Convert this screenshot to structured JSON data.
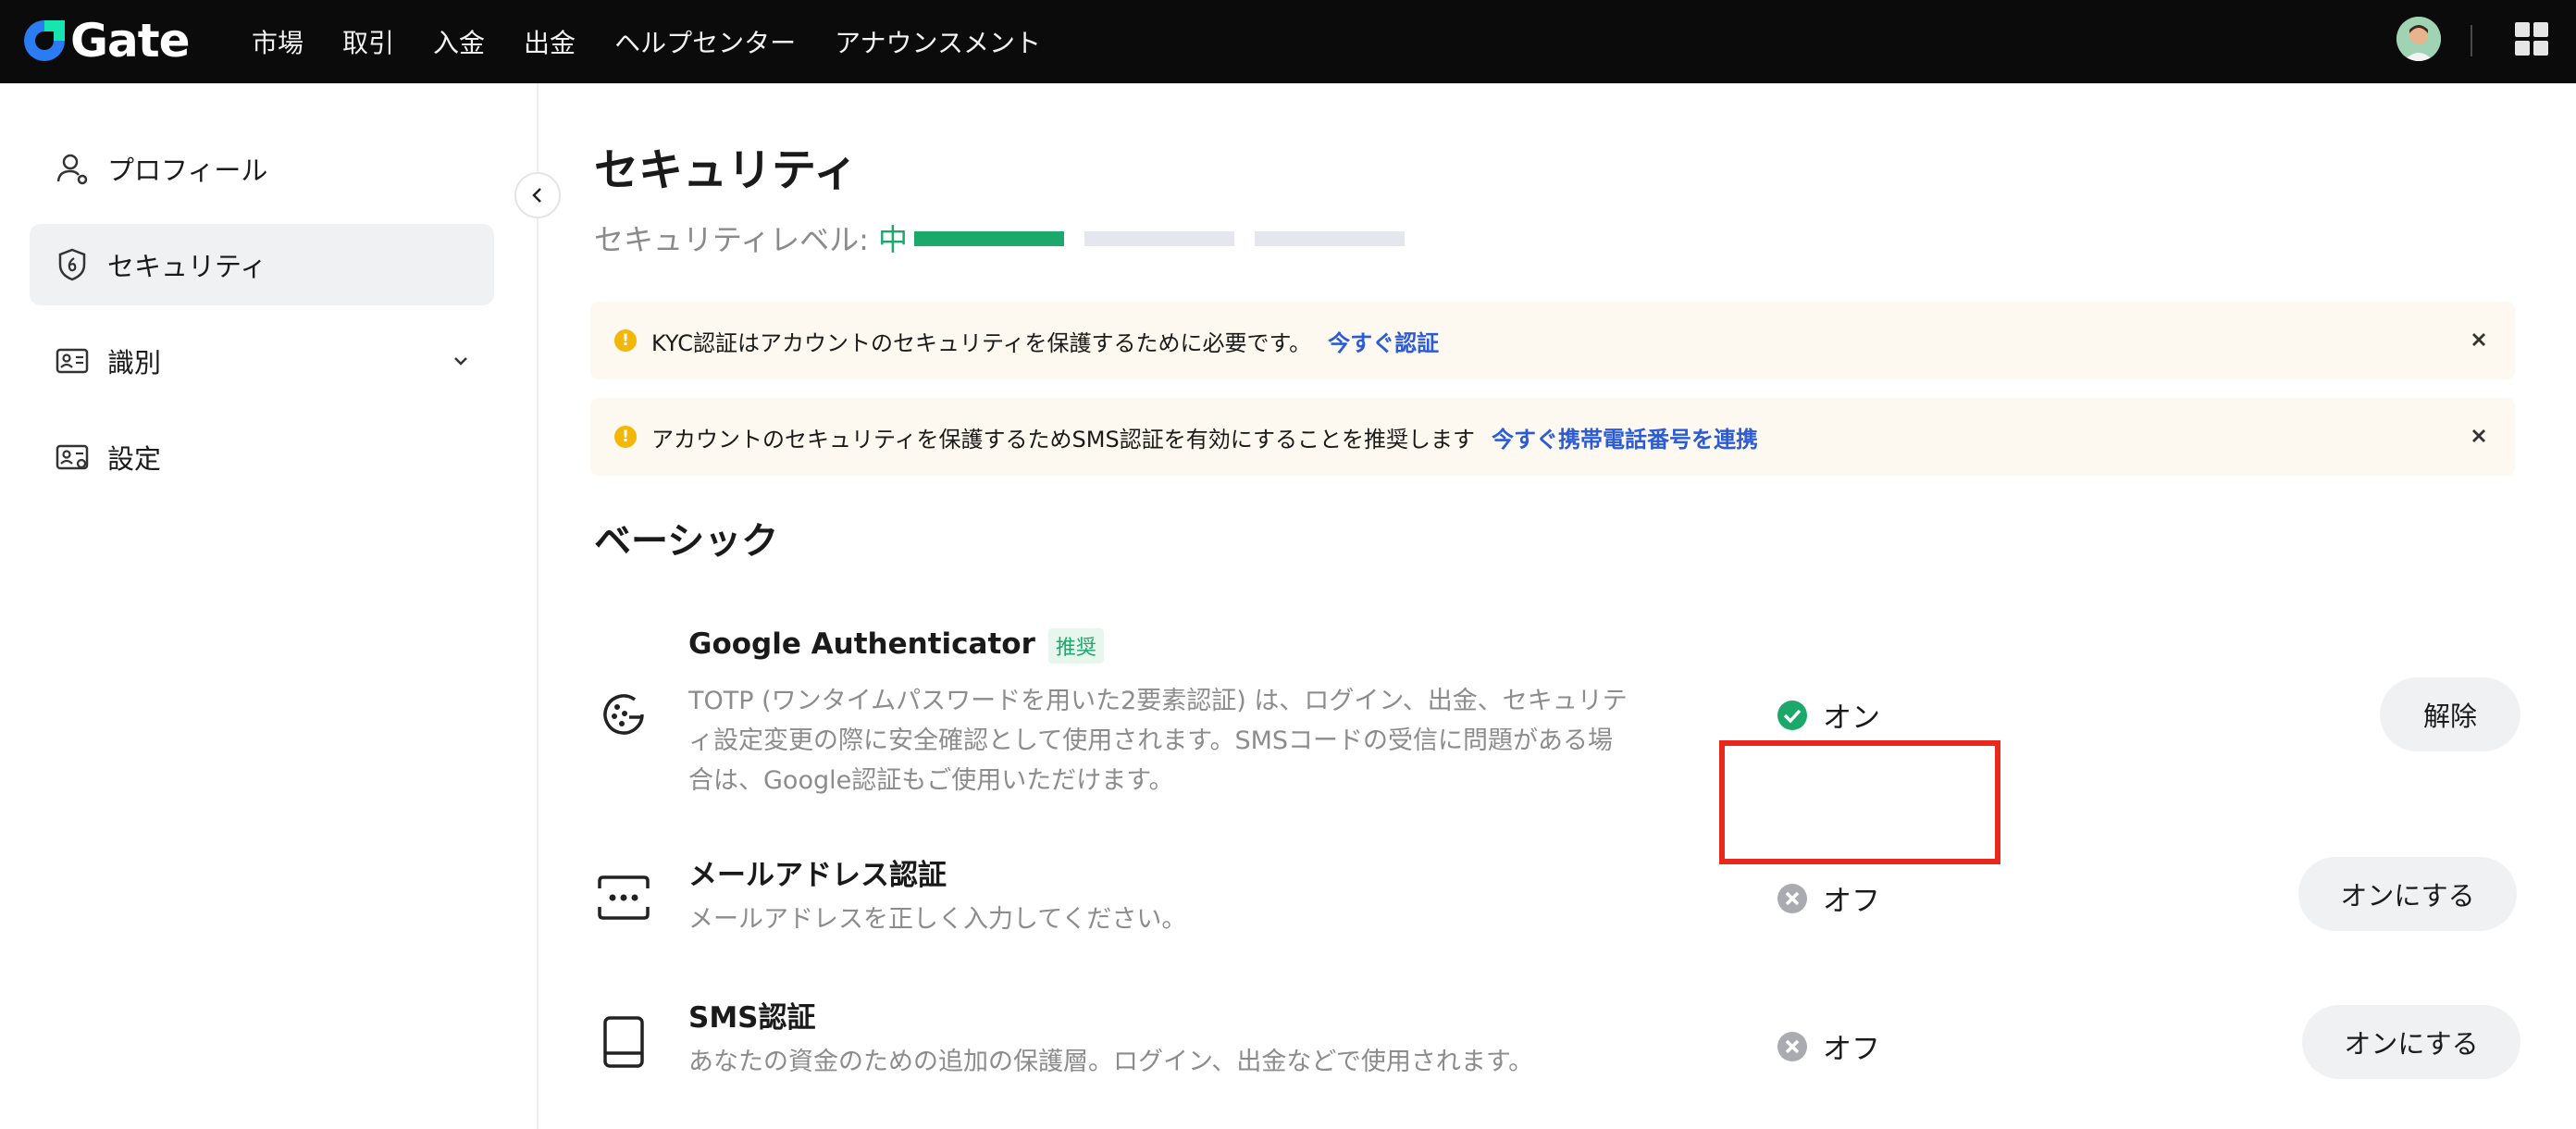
{
  "brand": {
    "name": "Gate",
    "accent": "#2b7bf5"
  },
  "topnav": {
    "items": [
      "市場",
      "取引",
      "入金",
      "出金",
      "ヘルプセンター",
      "アナウンスメント"
    ]
  },
  "sidebar": {
    "items": [
      {
        "label": "プロフィール",
        "icon": "user-icon"
      },
      {
        "label": "セキュリティ",
        "icon": "shield-icon",
        "active": true
      },
      {
        "label": "識別",
        "icon": "id-card-icon",
        "expandable": true
      },
      {
        "label": "設定",
        "icon": "settings-card-icon"
      }
    ]
  },
  "page": {
    "title": "セキュリティ",
    "security_level_label": "セキュリティレベル: ",
    "security_level_value": "中",
    "security_level_segments_filled": 1,
    "security_level_segments_total": 3
  },
  "alerts": [
    {
      "text": "KYC認証はアカウントのセキュリティを保護するために必要です。",
      "link": "今すぐ認証"
    },
    {
      "text": "アカウントのセキュリティを保護するためSMS認証を有効にすることを推奨します",
      "link": "今すぐ携帯電話番号を連携"
    }
  ],
  "basic": {
    "section_title": "ベーシック",
    "rows": [
      {
        "title": "Google Authenticator",
        "badge": "推奨",
        "desc_lines": [
          "TOTP (ワンタイムパスワードを用いた2要素認証) は、ログイン、出金、セキュリテ",
          "ィ設定変更の際に安全確認として使用されます。SMSコードの受信に問題がある場",
          "合は、Google認証もご使用いただけます。"
        ],
        "status": "オン",
        "button": "解除"
      },
      {
        "title": "メールアドレス認証",
        "desc_lines": [
          "メールアドレスを正しく入力してください。"
        ],
        "status": "オフ",
        "button": "オンにする"
      },
      {
        "title": "SMS認証",
        "desc_lines": [
          "あなたの資金のための追加の保護層。ログイン、出金などで使用されます。"
        ],
        "status": "オフ",
        "button": "オンにする"
      }
    ]
  },
  "colors": {
    "status_on": "#1aa86b",
    "status_off": "#a9abb0",
    "highlight": "#e8281c"
  }
}
